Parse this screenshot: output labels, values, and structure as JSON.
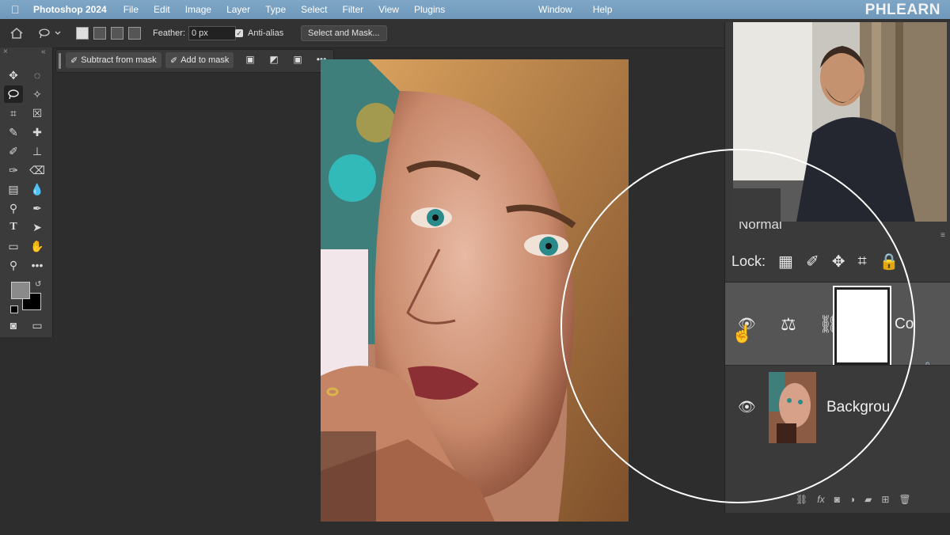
{
  "menubar": {
    "app_name": "Photoshop 2024",
    "items": [
      "File",
      "Edit",
      "Image",
      "Layer",
      "Type",
      "Select",
      "Filter",
      "View",
      "Plugins"
    ],
    "right_items": [
      "Window",
      "Help"
    ],
    "brand": "PHLEARN"
  },
  "options": {
    "feather_label": "Feather:",
    "feather_value": "0 px",
    "anti_alias_label": "Anti-alias",
    "select_and_mask_label": "Select and Mask..."
  },
  "taskbar": {
    "subtract_label": "Subtract from mask",
    "add_label": "Add to mask"
  },
  "layers": {
    "blend_mode": "Normal",
    "lock_label": "Lock:",
    "layer1_name": "Co",
    "layer2_name": "Backgrou"
  },
  "colors": {
    "menubar": "#7fa6c6",
    "panel_bg": "#3a3a3a",
    "selected_layer": "#555555",
    "canvas_bg": "#2d2d2d"
  }
}
